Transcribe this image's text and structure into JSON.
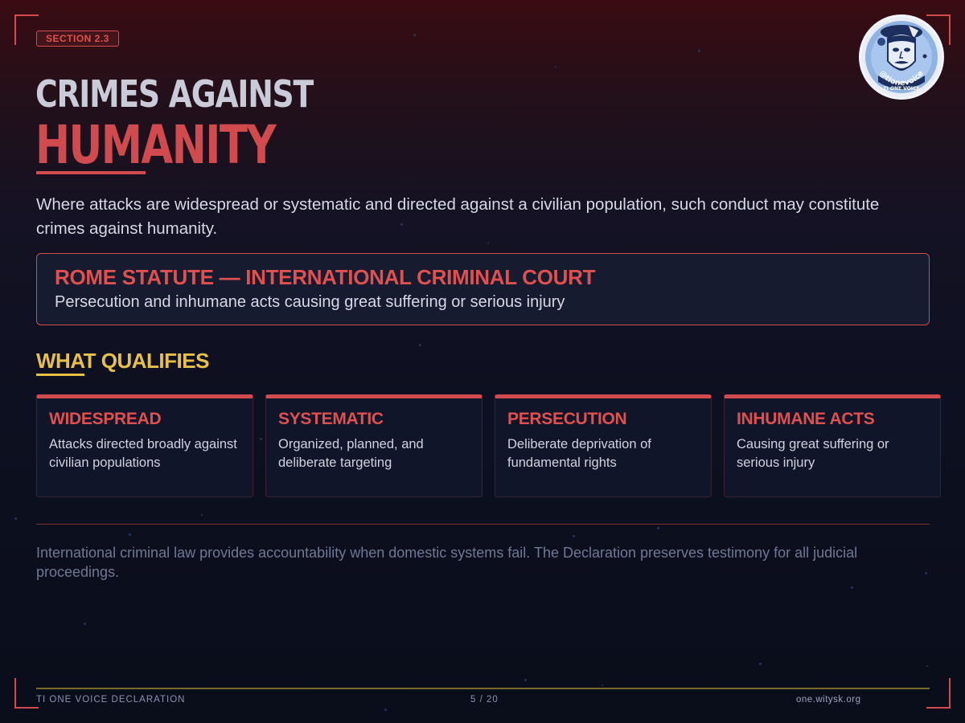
{
  "section_badge": "SECTION 2.3",
  "title_line1": "CRIMES AGAINST",
  "title_line2": "HUMANITY",
  "intro": "Where attacks are widespread or systematic and directed against a civilian population, such conduct may constitute crimes against humanity.",
  "statute": {
    "title": "ROME STATUTE — INTERNATIONAL CRIMINAL COURT",
    "subtitle": "Persecution and inhumane acts causing great suffering or serious injury"
  },
  "qualifies_heading": "WHAT QUALIFIES",
  "cards": [
    {
      "title": "WIDESPREAD",
      "text": "Attacks directed broadly against civilian populations"
    },
    {
      "title": "SYSTEMATIC",
      "text": "Organized, planned, and deliberate targeting"
    },
    {
      "title": "PERSECUTION",
      "text": "Deliberate deprivation of fundamental rights"
    },
    {
      "title": "INHUMANE ACTS",
      "text": "Causing great suffering or serious injury"
    }
  ],
  "closing": "International criminal law provides accountability when domestic systems fail. The Declaration preserves testimony for all judicial proceedings.",
  "footer": {
    "left": "TI ONE VOICE DECLARATION",
    "page": "5 / 20",
    "right": "one.witysk.org"
  },
  "logo": {
    "handle": "@tionevoice",
    "name": "TI ONE VOICE"
  },
  "colors": {
    "accent_red": "#d04a4e",
    "accent_gold": "#e7c04a",
    "background": "#0d1020"
  }
}
